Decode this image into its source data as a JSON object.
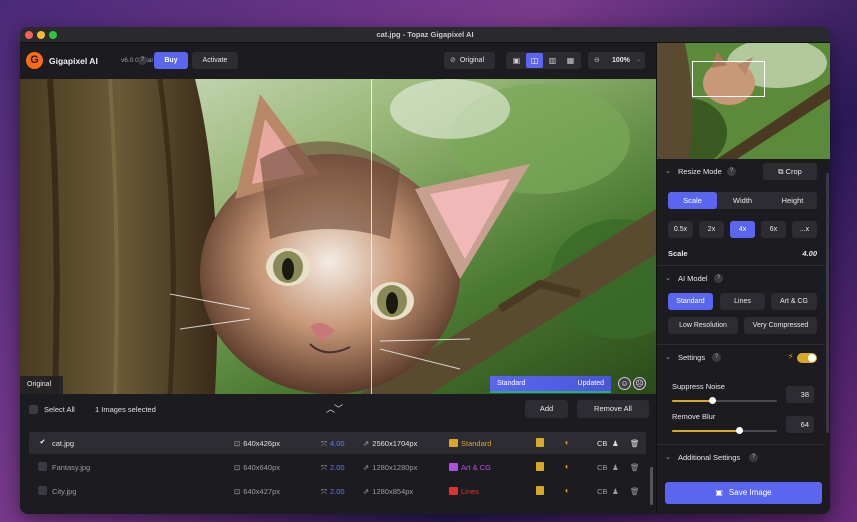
{
  "window": {
    "title": "cat.jpg - Topaz Gigapixel AI"
  },
  "toolbar": {
    "app_name": "Gigapixel AI",
    "version": "v6.0.0 Trial",
    "help": "?",
    "buy_label": "Buy",
    "activate_label": "Activate",
    "original_label": "Original",
    "zoom_value": "100%"
  },
  "preview": {
    "original_label": "Original",
    "model_label": "Standard",
    "status_label": "Updated"
  },
  "list": {
    "select_all_label": "Select All",
    "selected_count": "1 Images selected",
    "add_label": "Add",
    "remove_all_label": "Remove All",
    "files": [
      {
        "name": "cat.jpg",
        "input": "640x426px",
        "scale": "4.00",
        "output": "2560x1704px",
        "model": "Standard",
        "model_color": "#d8a828",
        "face": "CB",
        "selected": true
      },
      {
        "name": "Fantasy.jpg",
        "input": "640x640px",
        "scale": "2.00",
        "output": "1280x1280px",
        "model": "Art & CG",
        "model_color": "#b050e0",
        "face": "CB",
        "selected": false
      },
      {
        "name": "City.jpg",
        "input": "640x427px",
        "scale": "2.00",
        "output": "1280x854px",
        "model": "Lines",
        "model_color": "#e03030",
        "face": "CB",
        "selected": false
      }
    ]
  },
  "panel": {
    "resize_mode_title": "Resize Mode",
    "crop_label": "Crop",
    "resize_tabs": [
      "Scale",
      "Width",
      "Height"
    ],
    "scale_options": [
      "0.5x",
      "2x",
      "4x",
      "6x",
      "...x"
    ],
    "scale_label": "Scale",
    "scale_value": "4.00",
    "ai_model_title": "AI Model",
    "models": [
      "Standard",
      "Lines",
      "Art & CG",
      "Low Resolution",
      "Very Compressed"
    ],
    "settings_title": "Settings",
    "suppress_noise_label": "Suppress Noise",
    "suppress_noise_value": "38",
    "suppress_noise_level": 38,
    "remove_blur_label": "Remove Blur",
    "remove_blur_value": "64",
    "remove_blur_level": 64,
    "additional_settings_title": "Additional Settings",
    "save_label": "Save Image"
  },
  "colors": {
    "accent": "#5a66f0",
    "highlight": "#d8a828"
  }
}
